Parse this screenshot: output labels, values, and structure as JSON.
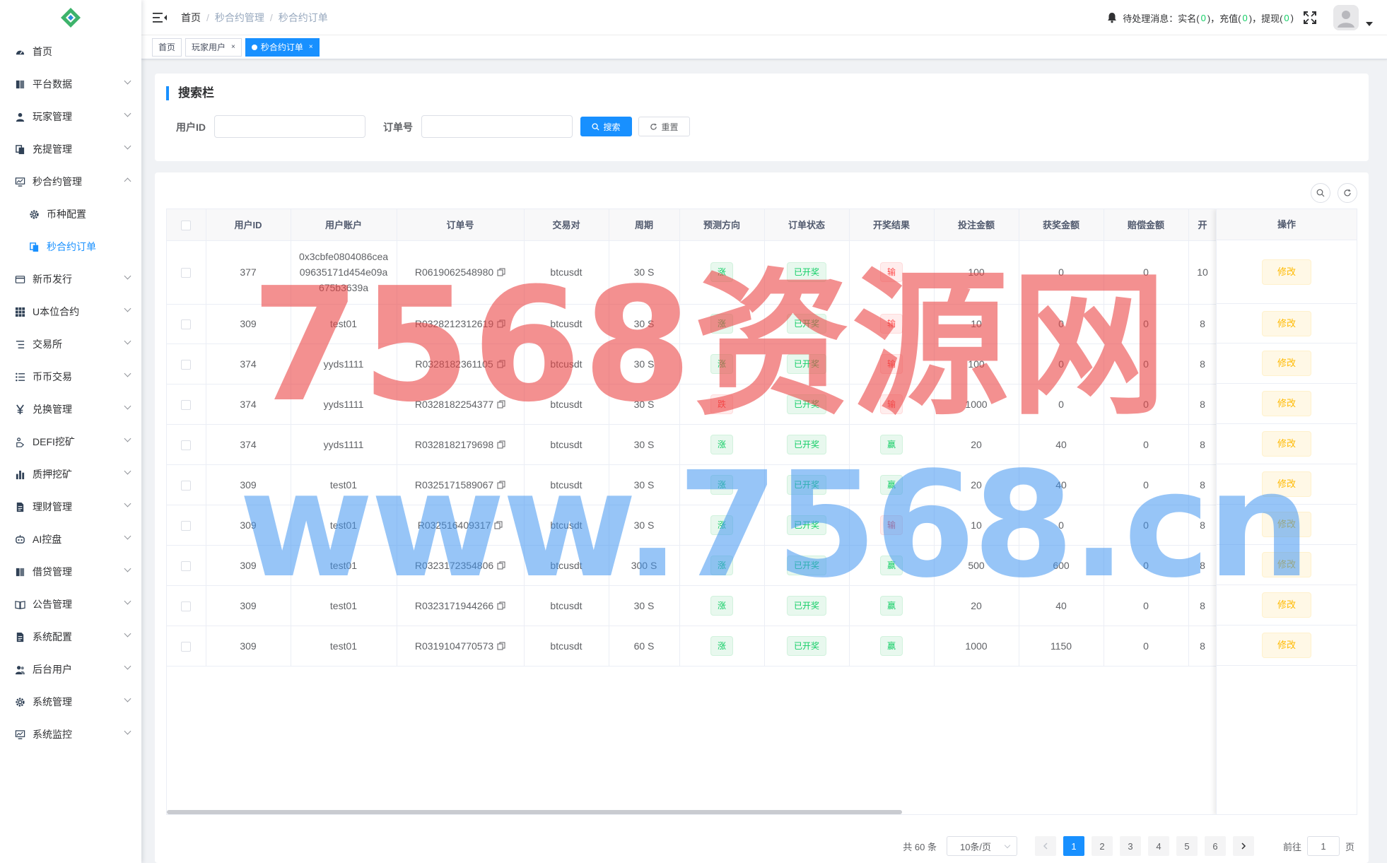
{
  "sidebar": {
    "items": [
      {
        "label": "首页",
        "icon": "dashboard-icon",
        "arrow": false
      },
      {
        "label": "平台数据",
        "icon": "book-icon",
        "arrow": "down"
      },
      {
        "label": "玩家管理",
        "icon": "user-icon",
        "arrow": "down"
      },
      {
        "label": "充提管理",
        "icon": "copy-icon",
        "arrow": "down"
      },
      {
        "label": "秒合约管理",
        "icon": "monitor-chart-icon",
        "arrow": "up"
      },
      {
        "label": "币种配置",
        "icon": "gear-icon",
        "arrow": false,
        "sub": true
      },
      {
        "label": "秒合约订单",
        "icon": "copy-icon",
        "arrow": false,
        "sub": true,
        "active": true
      },
      {
        "label": "新币发行",
        "icon": "card-icon",
        "arrow": "down"
      },
      {
        "label": "U本位合约",
        "icon": "grid-icon",
        "arrow": "down"
      },
      {
        "label": "交易所",
        "icon": "list-icon",
        "arrow": "down"
      },
      {
        "label": "币币交易",
        "icon": "list-bullets-icon",
        "arrow": "down"
      },
      {
        "label": "兑换管理",
        "icon": "yen-icon",
        "arrow": "down"
      },
      {
        "label": "DEFI挖矿",
        "icon": "hand-icon",
        "arrow": "down"
      },
      {
        "label": "质押挖矿",
        "icon": "bar-chart-icon",
        "arrow": "down"
      },
      {
        "label": "理财管理",
        "icon": "document-icon",
        "arrow": "down"
      },
      {
        "label": "AI控盘",
        "icon": "robot-icon",
        "arrow": "down"
      },
      {
        "label": "借贷管理",
        "icon": "book-icon",
        "arrow": "down"
      },
      {
        "label": "公告管理",
        "icon": "open-book-icon",
        "arrow": "down"
      },
      {
        "label": "系统配置",
        "icon": "document-icon",
        "arrow": "down"
      },
      {
        "label": "后台用户",
        "icon": "users-icon",
        "arrow": "down"
      },
      {
        "label": "系统管理",
        "icon": "gear-icon",
        "arrow": "down"
      },
      {
        "label": "系统监控",
        "icon": "monitor-chart-icon",
        "arrow": "down"
      }
    ]
  },
  "navbar": {
    "breadcrumb": [
      "首页",
      "秒合约管理",
      "秒合约订单"
    ],
    "notice_prefix": "待处理消息：",
    "notices": [
      {
        "label": "实名(",
        "count": "0",
        "suffix": ")，"
      },
      {
        "label": "充值(",
        "count": "0",
        "suffix": ")，"
      },
      {
        "label": "提现(",
        "count": "0",
        "suffix": ")"
      }
    ]
  },
  "tags": [
    {
      "label": "首页",
      "active": false,
      "closable": false
    },
    {
      "label": "玩家用户",
      "active": false,
      "closable": true
    },
    {
      "label": "秒合约订单",
      "active": true,
      "closable": true
    }
  ],
  "search": {
    "title": "搜索栏",
    "user_id_label": "用户ID",
    "order_no_label": "订单号",
    "search_button": "搜索",
    "reset_button": "重置"
  },
  "table": {
    "columns": [
      "用户ID",
      "用户账户",
      "订单号",
      "交易对",
      "周期",
      "预测方向",
      "订单状态",
      "开奖结果",
      "投注金额",
      "获奖金额",
      "赔偿金额",
      "开"
    ],
    "op_header": "操作",
    "edit_label": "修改",
    "rows": [
      {
        "user_id": "377",
        "account": [
          "0x3cbfe0804086cea",
          "09635171d454e09a",
          "675b3639a"
        ],
        "order_no": "R0619062548980",
        "pair": "btcusdt",
        "period": "30 S",
        "direction": "涨",
        "status": "已开奖",
        "result": "输",
        "bet": "100",
        "win": "0",
        "comp": "0",
        "extra": "10"
      },
      {
        "user_id": "309",
        "account": [
          "test01"
        ],
        "order_no": "R0328212312619",
        "pair": "btcusdt",
        "period": "30 S",
        "direction": "涨",
        "status": "已开奖",
        "result": "输",
        "bet": "10",
        "win": "0",
        "comp": "0",
        "extra": "8"
      },
      {
        "user_id": "374",
        "account": [
          "yyds1111"
        ],
        "order_no": "R0328182361105",
        "pair": "btcusdt",
        "period": "30 S",
        "direction": "涨",
        "status": "已开奖",
        "result": "输",
        "bet": "100",
        "win": "0",
        "comp": "0",
        "extra": "8"
      },
      {
        "user_id": "374",
        "account": [
          "yyds1111"
        ],
        "order_no": "R0328182254377",
        "pair": "btcusdt",
        "period": "30 S",
        "direction": "跌",
        "status": "已开奖",
        "result": "输",
        "bet": "1000",
        "win": "0",
        "comp": "0",
        "extra": "8"
      },
      {
        "user_id": "374",
        "account": [
          "yyds1111"
        ],
        "order_no": "R0328182179698",
        "pair": "btcusdt",
        "period": "30 S",
        "direction": "涨",
        "status": "已开奖",
        "result": "赢",
        "bet": "20",
        "win": "40",
        "comp": "0",
        "extra": "8"
      },
      {
        "user_id": "309",
        "account": [
          "test01"
        ],
        "order_no": "R0325171589067",
        "pair": "btcusdt",
        "period": "30 S",
        "direction": "涨",
        "status": "已开奖",
        "result": "赢",
        "bet": "20",
        "win": "40",
        "comp": "0",
        "extra": "8"
      },
      {
        "user_id": "309",
        "account": [
          "test01"
        ],
        "order_no": "R032516409317",
        "pair": "btcusdt",
        "period": "30 S",
        "direction": "涨",
        "status": "已开奖",
        "result": "输",
        "bet": "10",
        "win": "0",
        "comp": "0",
        "extra": "8"
      },
      {
        "user_id": "309",
        "account": [
          "test01"
        ],
        "order_no": "R0323172354806",
        "pair": "btcusdt",
        "period": "300 S",
        "direction": "涨",
        "status": "已开奖",
        "result": "赢",
        "bet": "500",
        "win": "600",
        "comp": "0",
        "extra": "8"
      },
      {
        "user_id": "309",
        "account": [
          "test01"
        ],
        "order_no": "R0323171944266",
        "pair": "btcusdt",
        "period": "30 S",
        "direction": "涨",
        "status": "已开奖",
        "result": "赢",
        "bet": "20",
        "win": "40",
        "comp": "0",
        "extra": "8"
      },
      {
        "user_id": "309",
        "account": [
          "test01"
        ],
        "order_no": "R0319104770573",
        "pair": "btcusdt",
        "period": "60 S",
        "direction": "涨",
        "status": "已开奖",
        "result": "赢",
        "bet": "1000",
        "win": "1150",
        "comp": "0",
        "extra": "8"
      }
    ]
  },
  "pagination": {
    "total": "共 60 条",
    "page_size": "10条/页",
    "pages": [
      "1",
      "2",
      "3",
      "4",
      "5",
      "6"
    ],
    "current": "1",
    "goto_label": "前往",
    "goto_value": "1",
    "page_unit": "页"
  },
  "watermark": {
    "line1": "7568资源网",
    "line2": "www.7568.cn"
  },
  "colors": {
    "primary": "#1890ff",
    "success": "#13ce66",
    "danger": "#ff4949",
    "warning": "#ffba00"
  }
}
